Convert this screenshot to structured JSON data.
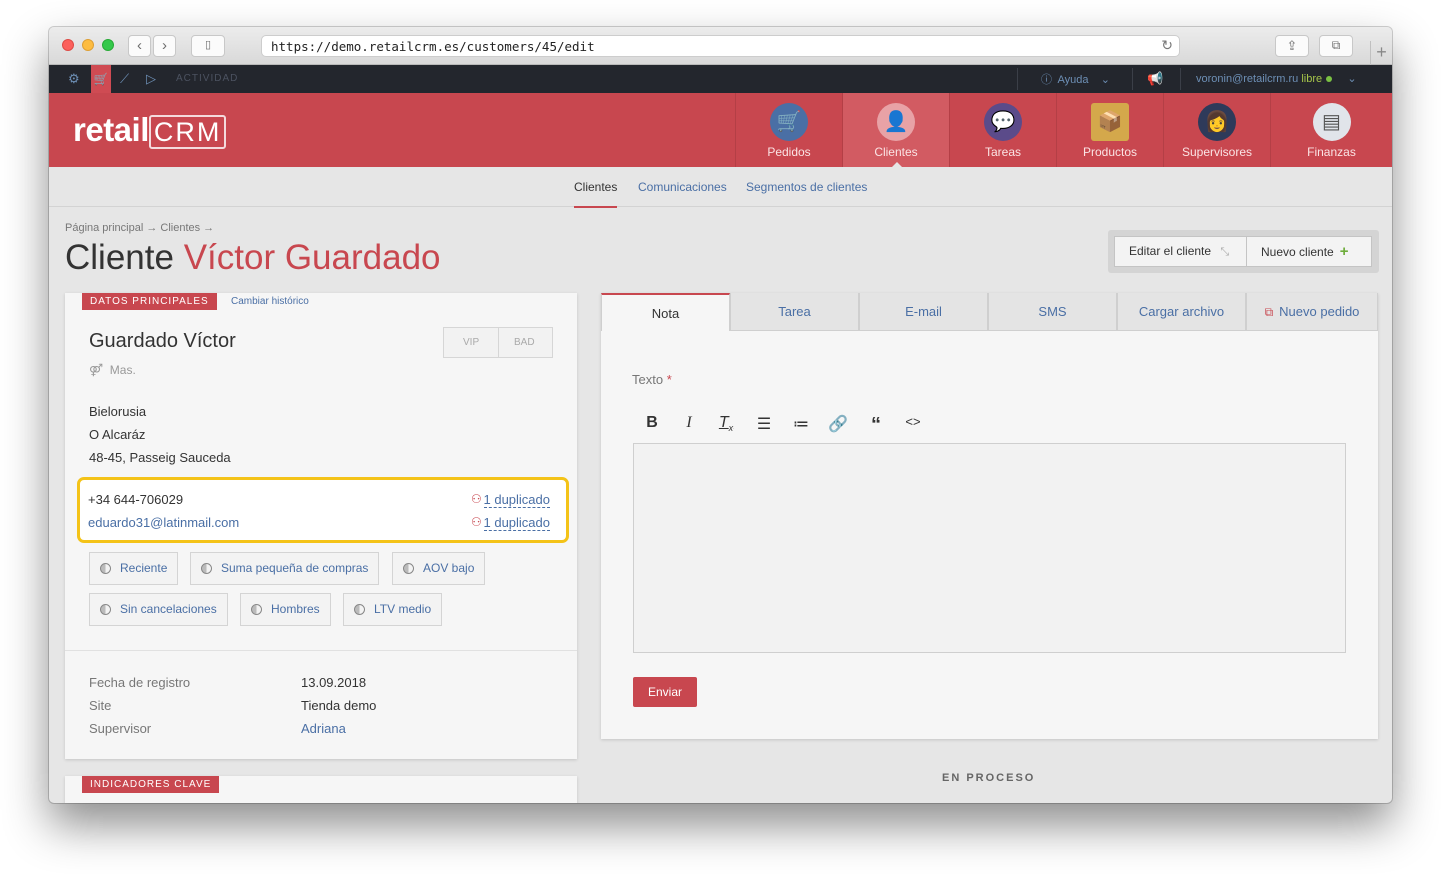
{
  "browser": {
    "url": "https://demo.retailcrm.es/customers/45/edit"
  },
  "topbar": {
    "actividad": "ACTIVIDAD",
    "ayuda": "Ayuda",
    "user_email": "voronin@retailcrm.ru",
    "user_status": "libre"
  },
  "header": {
    "logo_text": "retail",
    "logo_crm": "CRM",
    "nav": [
      {
        "label": "Pedidos",
        "icon": "cart-icon"
      },
      {
        "label": "Clientes",
        "icon": "customer-icon"
      },
      {
        "label": "Tareas",
        "icon": "tasks-icon"
      },
      {
        "label": "Productos",
        "icon": "box-icon"
      },
      {
        "label": "Supervisores",
        "icon": "supervisor-icon"
      },
      {
        "label": "Finanzas",
        "icon": "finance-icon"
      }
    ]
  },
  "subnav": {
    "tabs": [
      "Clientes",
      "Comunicaciones",
      "Segmentos de clientes"
    ]
  },
  "page": {
    "breadcrumb": "Página principal → Clientes →",
    "title_prefix": "Cliente",
    "title_name": "Víctor Guardado",
    "edit_button": "Editar el cliente",
    "new_button": "Nuevo cliente"
  },
  "main_card": {
    "tag": "DATOS PRINCIPALES",
    "history_link": "Cambiar histórico",
    "name": "Guardado Víctor",
    "vip": "VIP",
    "bad": "BAD",
    "gender": "Mas.",
    "address": [
      "Bielorusia",
      "O Alcaráz",
      "48-45, Passeig Sauceda"
    ],
    "phone": "+34 644-706029",
    "email": "eduardo31@latinmail.com",
    "phone_dup": "1 duplicado",
    "email_dup": "1 duplicado",
    "segments": [
      "Reciente",
      "Suma pequeña de compras",
      "AOV bajo",
      "Sin cancelaciones",
      "Hombres",
      "LTV medio"
    ],
    "fields": [
      {
        "label": "Fecha de registro",
        "value": "13.09.2018"
      },
      {
        "label": "Site",
        "value": "Tienda demo"
      },
      {
        "label": "Supervisor",
        "value": "Adriana"
      }
    ]
  },
  "kpi_card": {
    "tag": "INDICADORES CLAVE"
  },
  "right_panel": {
    "tabs": [
      "Nota",
      "Tarea",
      "E-mail",
      "SMS",
      "Cargar archivo",
      "Nuevo pedido"
    ],
    "texto_label": "Texto",
    "required_mark": "*",
    "toolbar": [
      "bold-icon",
      "italic-icon",
      "clear-format-icon",
      "bulleted-list-icon",
      "numbered-list-icon",
      "link-icon",
      "quote-icon",
      "code-icon"
    ],
    "send_button": "Enviar"
  },
  "footer": {
    "en_proceso": "EN PROCESO"
  },
  "colors": {
    "brand_red": "#c8474f",
    "highlight_yellow": "#f4c318",
    "link_blue": "#4a6fa5"
  }
}
